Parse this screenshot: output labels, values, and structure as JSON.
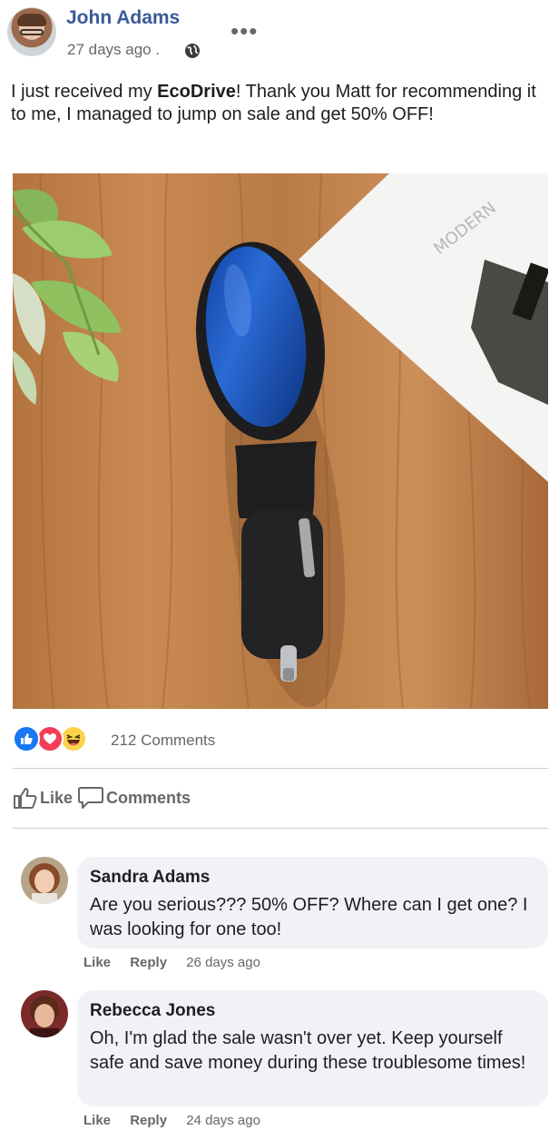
{
  "post": {
    "author": "John Adams",
    "time": "27 days ago .",
    "text_before": "I just received my ",
    "text_bold": "EcoDrive",
    "text_after": "! Thank you Matt for recommending it to me, I managed to jump on sale and get 50% OFF!",
    "image_alt": "EcoDrive device on wooden table",
    "magazine_text": "MODERN",
    "reactions": [
      "like",
      "love",
      "haha"
    ],
    "comments_count": "212 Comments",
    "actions": {
      "like": "Like",
      "comments": "Comments"
    }
  },
  "comments": [
    {
      "name": "Sandra Adams",
      "text": "Are you serious??? 50% OFF? Where can I get one? I was looking for one too!",
      "like": "Like",
      "reply": "Reply",
      "time": "26 days ago"
    },
    {
      "name": "Rebecca Jones",
      "text": "Oh, I'm glad the sale wasn't over yet. Keep yourself safe and save money during these troublesome times!",
      "like": "Like",
      "reply": "Reply",
      "time": "24 days ago"
    }
  ],
  "colors": {
    "author": "#3b5998",
    "meta": "#65676b",
    "like_blue": "#1877f2",
    "love_red": "#f33e58",
    "bubble": "#f0f2f5"
  },
  "icons": [
    "globe-icon",
    "more-options-icon",
    "like-reaction-icon",
    "love-reaction-icon",
    "haha-reaction-icon",
    "thumb-up-icon",
    "comment-icon"
  ]
}
